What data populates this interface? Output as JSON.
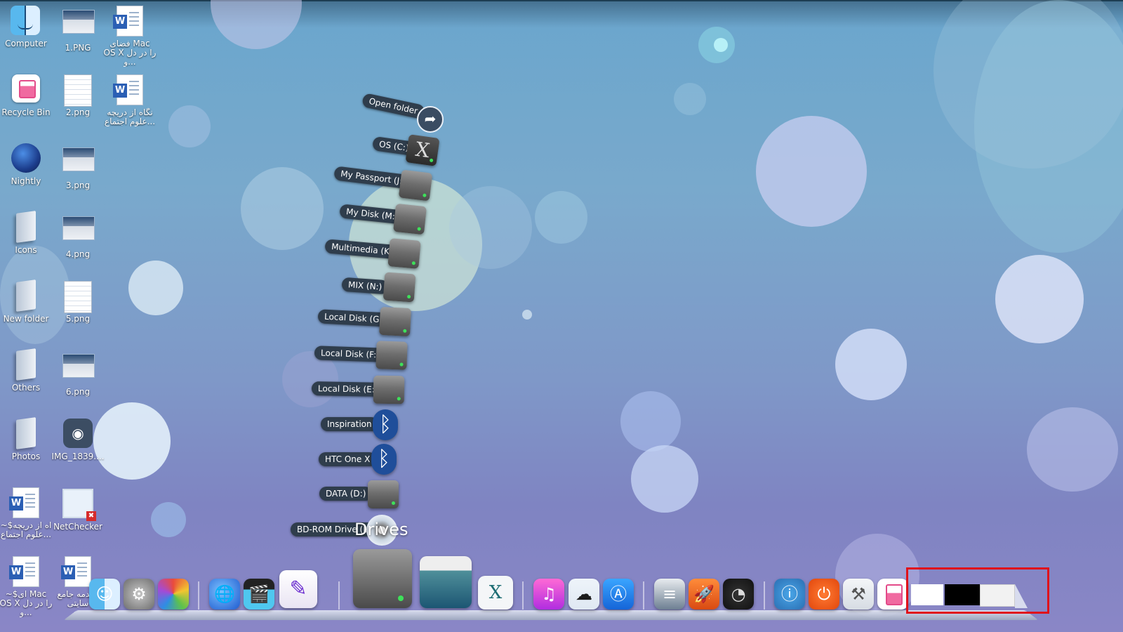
{
  "desktop": {
    "icons": [
      {
        "label": "Computer",
        "icon": "finder-icon"
      },
      {
        "label": "1.PNG",
        "icon": "image-file-icon"
      },
      {
        "label": "فضای Mac OS X را در دل و...",
        "icon": "word-document-icon"
      },
      {
        "label": "Recycle Bin",
        "icon": "recycle-bin-icon"
      },
      {
        "label": "2.png",
        "icon": "image-file-icon"
      },
      {
        "label": "نگاه از دریچه علوم اجتماع...",
        "icon": "word-document-icon"
      },
      {
        "label": "Nightly",
        "icon": "nightly-browser-icon"
      },
      {
        "label": "3.png",
        "icon": "image-file-icon"
      },
      {
        "label": "Icons",
        "icon": "folder-icon"
      },
      {
        "label": "4.png",
        "icon": "image-file-icon"
      },
      {
        "label": "New folder",
        "icon": "folder-icon"
      },
      {
        "label": "5.png",
        "icon": "image-file-icon"
      },
      {
        "label": "Others",
        "icon": "folder-icon"
      },
      {
        "label": "6.png",
        "icon": "image-file-icon"
      },
      {
        "label": "Photos",
        "icon": "folder-icon"
      },
      {
        "label": "IMG_1839....",
        "icon": "camera-icon"
      },
      {
        "label": "~$اه از دریچه علوم اجتماع...",
        "icon": "word-document-icon"
      },
      {
        "label": "NetChecker",
        "icon": "network-checker-icon"
      },
      {
        "label": "~$ای Mac OS X را در دل و...",
        "icon": "word-document-icon"
      },
      {
        "label": "مقدمه جامع سایتی",
        "icon": "word-document-icon"
      }
    ]
  },
  "drives_stack": {
    "title": "Drives",
    "open_folder_label": "Open folder",
    "items": [
      {
        "label": "OS (C:)",
        "kind": "os-drive"
      },
      {
        "label": "My Passport (J:)",
        "kind": "drive"
      },
      {
        "label": "My Disk (M:)",
        "kind": "drive"
      },
      {
        "label": "Multimedia (K:)",
        "kind": "drive"
      },
      {
        "label": "MIX (N:)",
        "kind": "drive"
      },
      {
        "label": "Local Disk (G:)",
        "kind": "drive"
      },
      {
        "label": "Local Disk (F:)",
        "kind": "drive"
      },
      {
        "label": "Local Disk (E:)",
        "kind": "drive"
      },
      {
        "label": "Inspiration",
        "kind": "bluetooth"
      },
      {
        "label": "HTC One X",
        "kind": "bluetooth"
      },
      {
        "label": "DATA (D:)",
        "kind": "drive"
      },
      {
        "label": "BD-ROM Drive (L:)",
        "kind": "optical"
      }
    ]
  },
  "dock": {
    "items": [
      {
        "name": "Finder",
        "icon": "finder-icon"
      },
      {
        "name": "System Preferences",
        "icon": "gear-icon"
      },
      {
        "name": "Color Picker",
        "icon": "color-wheel-icon"
      },
      {
        "name": "Globe",
        "icon": "globe-icon"
      },
      {
        "name": "Movie",
        "icon": "clapperboard-icon"
      },
      {
        "name": "Pen",
        "icon": "pen-icon"
      },
      {
        "name": "Drives",
        "icon": "drive-stack-icon"
      },
      {
        "name": "Mac OS",
        "icon": "mac-os-icon"
      },
      {
        "name": "X",
        "icon": "x-icon"
      },
      {
        "name": "iTunes",
        "icon": "music-note-icon"
      },
      {
        "name": "Cloud",
        "icon": "cloud-icon"
      },
      {
        "name": "App Store",
        "icon": "app-store-icon"
      },
      {
        "name": "Documents",
        "icon": "documents-icon"
      },
      {
        "name": "Rocket",
        "icon": "rocket-icon"
      },
      {
        "name": "Dashboard",
        "icon": "gauge-icon"
      },
      {
        "name": "Info",
        "icon": "info-icon"
      },
      {
        "name": "Power",
        "icon": "power-icon"
      },
      {
        "name": "Applications",
        "icon": "applications-icon"
      },
      {
        "name": "Recycle Bin",
        "icon": "recycle-bin-icon"
      }
    ],
    "x_glyph": "X"
  },
  "colors": {
    "highlight_box": "#e0121a",
    "pill_bg": "#2f3d4c",
    "led": "#3ee05a"
  }
}
